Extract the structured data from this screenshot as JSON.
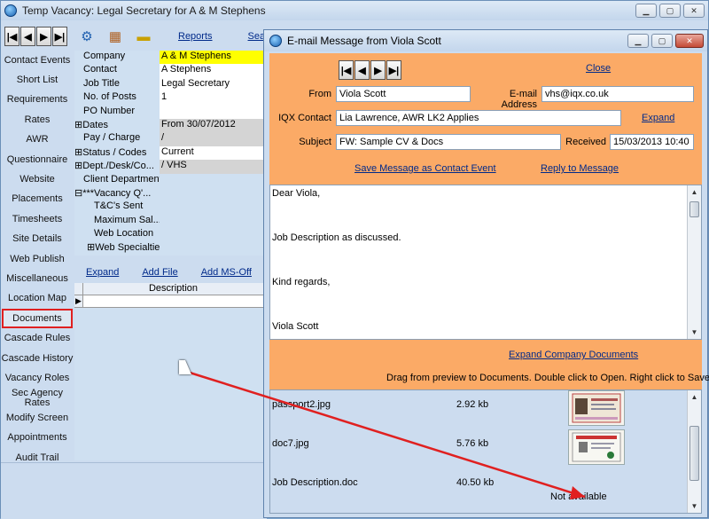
{
  "main_window": {
    "title": "Temp Vacancy: Legal Secretary for A & M Stephens",
    "links": {
      "reports": "Reports",
      "search": "Sea"
    }
  },
  "sidebar": {
    "items": [
      "Contact Events",
      "Short List",
      "Requirements",
      "Rates",
      "AWR",
      "Questionnaire",
      "Website",
      "Placements",
      "Timesheets",
      "Site Details",
      "Web Publish",
      "Miscellaneous",
      "Location Map",
      "Documents",
      "Cascade Rules",
      "Cascade History",
      "Vacancy Roles",
      "Sec Agency Rates",
      "Modify Screen",
      "Appointments",
      "Audit Trail"
    ]
  },
  "properties": [
    {
      "label": "Company",
      "value": "A & M Stephens"
    },
    {
      "label": "Contact",
      "value": "A Stephens"
    },
    {
      "label": "Job Title",
      "value": "Legal Secretary"
    },
    {
      "label": "No. of Posts",
      "value": "1"
    },
    {
      "label": "PO Number",
      "value": ""
    },
    {
      "label": "Dates",
      "value": "From 30/07/2012"
    },
    {
      "label": "Pay / Charge",
      "value": " /"
    },
    {
      "label": "Status / Codes",
      "value": "Current"
    },
    {
      "label": "Dept./Desk/Co...",
      "value": " / VHS"
    },
    {
      "label": "Client Department",
      "value": ""
    },
    {
      "label": "***Vacancy Q'...",
      "value": ""
    },
    {
      "label": "T&C's Sent",
      "value": ""
    },
    {
      "label": "Maximum Sal...",
      "value": ""
    },
    {
      "label": "Web Location",
      "value": ""
    },
    {
      "label": "Web Specialties",
      "value": ""
    }
  ],
  "doc_actions": {
    "expand": "Expand",
    "add_file": "Add File",
    "add_ms_office": "Add MS-Off"
  },
  "doc_grid": {
    "header": "Description"
  },
  "email": {
    "title": "E-mail Message from Viola Scott",
    "close": "Close",
    "from_label": "From",
    "from": "Viola Scott",
    "email_label": "E-mail Address",
    "email": "vhs@iqx.co.uk",
    "iqx_label": "IQX Contact",
    "iqx": "Lia Lawrence, AWR LK2 Applies",
    "expand": "Expand",
    "subject_label": "Subject",
    "subject": "FW: Sample CV & Docs",
    "received_label": "Received",
    "received": "15/03/2013 10:40",
    "save_link": "Save Message as Contact Event",
    "reply_link": "Reply to Message",
    "body": [
      "Dear Viola,",
      "Job Description as discussed.",
      "Kind regards,",
      "Viola Scott"
    ],
    "expand_company_docs": "Expand Company Documents",
    "hint": "Drag from preview to Documents.  Double click to Open.  Right click to Save",
    "attachments": [
      {
        "name": "passport2.jpg",
        "size": "2.92 kb",
        "preview": "image"
      },
      {
        "name": "doc7.jpg",
        "size": "5.76 kb",
        "preview": "image"
      },
      {
        "name": "Job Description.doc",
        "size": "40.50 kb",
        "preview": "Not available"
      }
    ]
  },
  "annotation": {
    "color": "#e02020"
  }
}
